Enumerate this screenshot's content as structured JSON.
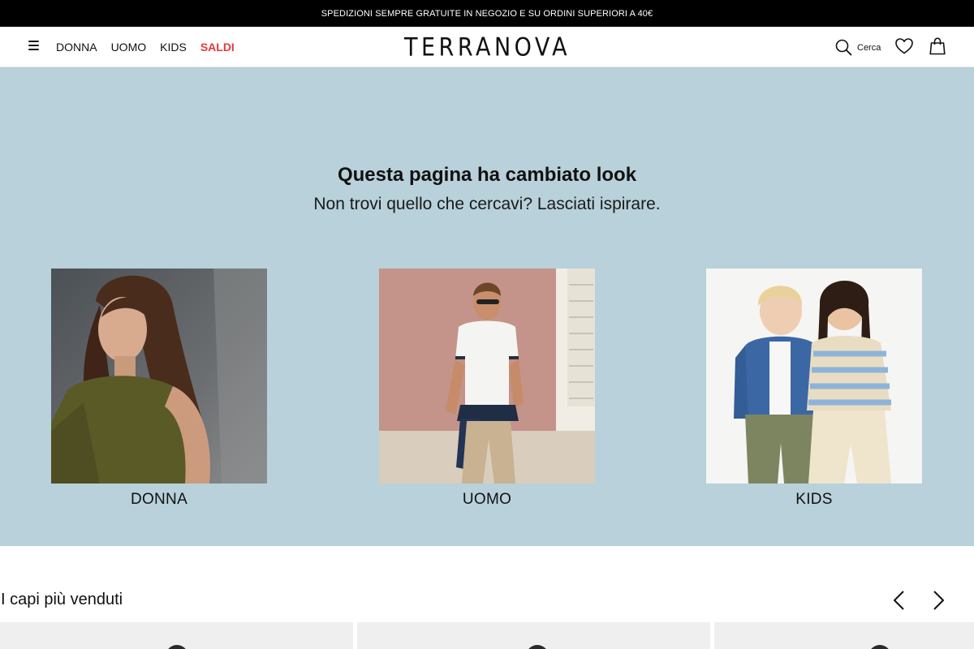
{
  "promo": {
    "text": "SPEDIZIONI SEMPRE GRATUITE  IN NEGOZIO E SU ORDINI SUPERIORI A 40€"
  },
  "header": {
    "menu_icon": "hamburger-icon",
    "nav": [
      {
        "label": "DONNA"
      },
      {
        "label": "UOMO"
      },
      {
        "label": "KIDS"
      },
      {
        "label": "SALDI",
        "color": "#e23b3b"
      }
    ],
    "logo": "TERRANOVA",
    "search_label": "Cerca",
    "icons": [
      "search-icon",
      "heart-icon",
      "shopping-bag-icon"
    ]
  },
  "hero": {
    "background": "#b8d1da",
    "title": "Questa pagina ha cambiato look",
    "subtitle": "Non trovi quello che cercavi? Lasciati ispirare.",
    "cards": [
      {
        "label": "DONNA"
      },
      {
        "label": "UOMO"
      },
      {
        "label": "KIDS"
      }
    ]
  },
  "bestsellers": {
    "title": "I capi più venduti",
    "icons": [
      "chevron-left-icon",
      "chevron-right-icon"
    ]
  }
}
